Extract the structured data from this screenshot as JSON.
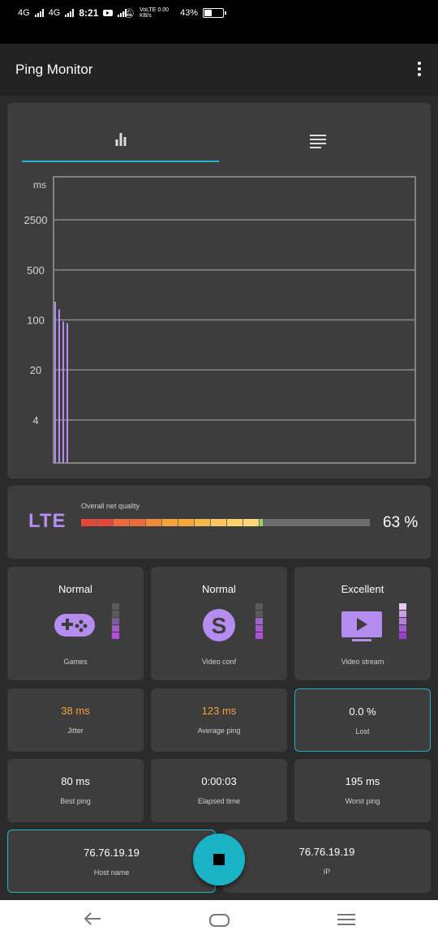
{
  "status_bar": {
    "net1": "4G",
    "net2": "4G",
    "time": "8:21",
    "right_text": "VoLTE 0.00 KB/s",
    "battery": "43%",
    "battery_level": 0.43
  },
  "app": {
    "title": "Ping Monitor"
  },
  "tabs": [
    {
      "icon": "bar-chart-icon",
      "selected": true
    },
    {
      "icon": "list-icon",
      "selected": false
    }
  ],
  "chart_data": {
    "type": "bar",
    "ylabel": "ms",
    "y_ticks": [
      "2500",
      "500",
      "100",
      "20",
      "4"
    ],
    "y_scale": "log",
    "ylim": [
      1,
      10000
    ],
    "values": [
      180,
      140,
      95,
      90
    ],
    "bar_color": "#b58df0",
    "grid": true
  },
  "quality": {
    "network": "LTE",
    "label": "Overall net quality",
    "percent_text": "63 %",
    "percent": 63,
    "segment_colors": [
      "#e0493a",
      "#e0493a",
      "#ea6b3d",
      "#ea6b3d",
      "#f08a3a",
      "#f4a23a",
      "#f5a93c",
      "#f5b84a",
      "#f9c660",
      "#fcd26e",
      "#fdd57a",
      "#9bcf6a"
    ]
  },
  "tiles": [
    {
      "rating": "Normal",
      "label": "Games",
      "icon": "gamepad-icon",
      "level_colors": [
        "#5a5a5a",
        "#5a5a5a",
        "#7a5a99",
        "#a25ac9",
        "#b04fd8"
      ]
    },
    {
      "rating": "Normal",
      "label": "Video conf",
      "icon": "skype-icon",
      "level_colors": [
        "#5a5a5a",
        "#5a5a5a",
        "#9a66c8",
        "#a25ac9",
        "#b04fd8"
      ]
    },
    {
      "rating": "Excellent",
      "label": "Video stream",
      "icon": "tv-icon",
      "level_colors": [
        "#e7c8ef",
        "#c99ee0",
        "#b57ed9",
        "#a35ad0",
        "#9a3fc8"
      ]
    }
  ],
  "stats": [
    {
      "value": "38 ms",
      "label": "Jitter",
      "color": "#f4a23a",
      "highlight": false
    },
    {
      "value": "123 ms",
      "label": "Average ping",
      "color": "#f4a23a",
      "highlight": false
    },
    {
      "value": "0.0 %",
      "label": "Lost",
      "color": "#ffffff",
      "highlight": true
    },
    {
      "value": "80 ms",
      "label": "Best ping",
      "color": "#ffffff",
      "highlight": false
    },
    {
      "value": "0:00:03",
      "label": "Elapsed time",
      "color": "#ffffff",
      "highlight": false
    },
    {
      "value": "195 ms",
      "label": "Worst ping",
      "color": "#ffffff",
      "highlight": false
    }
  ],
  "host": {
    "host_value": "76.76.19.19",
    "host_label": "Host name",
    "ip_value": "76.76.19.19",
    "ip_label": "IP"
  },
  "accent_color": "#1ab3c6"
}
